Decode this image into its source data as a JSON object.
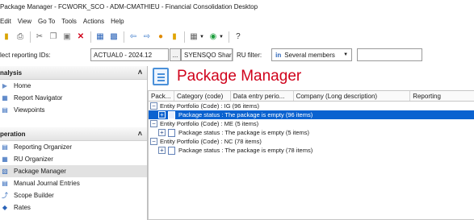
{
  "window": {
    "title": "Package Manager - FCWORK_SCO - ADM-CMATHIEU - Financial Consolidation Desktop"
  },
  "menu": [
    "Edit",
    "View",
    "Go To",
    "Tools",
    "Actions",
    "Help"
  ],
  "toolbar": {
    "icons": [
      "open-folder-icon",
      "print-icon",
      "cut-icon",
      "copy-icon",
      "paste-icon",
      "delete-icon",
      "document-view-icon",
      "properties-icon",
      "back-arrow-icon",
      "forward-arrow-icon",
      "user-icon",
      "folder-icon",
      "grid-icon",
      "refresh-icon",
      "help-icon"
    ]
  },
  "filter": {
    "label": "lect reporting IDs:",
    "reporting_id": "ACTUAL0 - 2024.12",
    "ellipsis": "...",
    "scope": "SYENSQO Shar...",
    "ru_filter_label": "RU filter:",
    "members_value": "Several members"
  },
  "left_panel": {
    "analysis": {
      "title": "nalysis",
      "items": [
        {
          "label": "Home",
          "icon": "home-icon"
        },
        {
          "label": "Report Navigator",
          "icon": "report-icon"
        },
        {
          "label": "Viewpoints",
          "icon": "viewpoints-icon"
        }
      ]
    },
    "operation": {
      "title": "peration",
      "items": [
        {
          "label": "Reporting Organizer",
          "icon": "organizer-icon"
        },
        {
          "label": "RU Organizer",
          "icon": "ru-organizer-icon"
        },
        {
          "label": "Package Manager",
          "icon": "package-icon"
        },
        {
          "label": "Manual Journal Entries",
          "icon": "journal-icon"
        },
        {
          "label": "Scope Builder",
          "icon": "scope-icon"
        },
        {
          "label": "Rates",
          "icon": "rates-icon"
        }
      ]
    }
  },
  "main": {
    "title": "Package Manager",
    "columns": [
      "Pack...",
      "Category (code)",
      "Data entry perio...",
      "Company (Long description)",
      "Reporting"
    ],
    "rows": [
      {
        "text": "Entity Portfolio (Code) : IG (96 items)",
        "level": 0,
        "selected": false
      },
      {
        "text": "Package status : The package is empty (96 items)",
        "level": 1,
        "selected": true
      },
      {
        "text": "Entity Portfolio (Code) : ME (5 items)",
        "level": 0,
        "selected": false
      },
      {
        "text": "Package status : The package is empty (5 items)",
        "level": 1,
        "selected": false
      },
      {
        "text": "Entity Portfolio (Code) : NC (78 items)",
        "level": 0,
        "selected": false
      },
      {
        "text": "Package status : The package is empty (78 items)",
        "level": 1,
        "selected": false
      }
    ]
  }
}
